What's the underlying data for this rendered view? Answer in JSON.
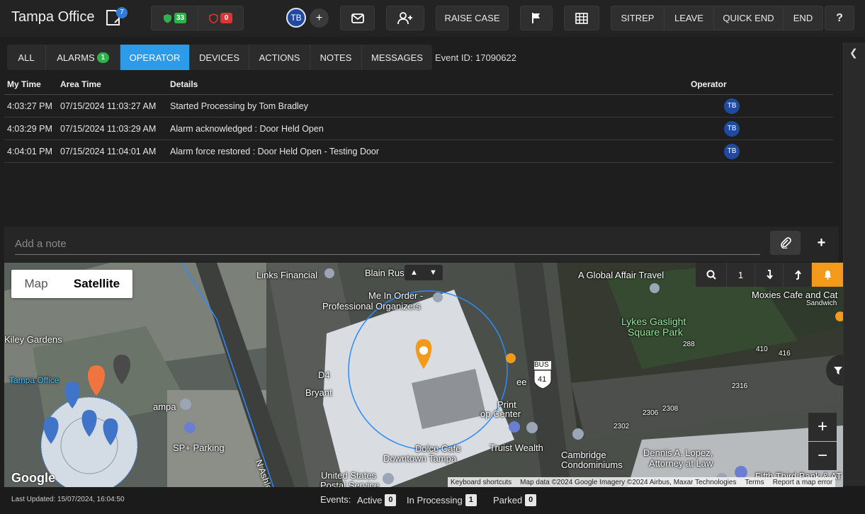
{
  "header": {
    "site_title": "Tampa Office",
    "doc_badge": "7",
    "secure_count": "33",
    "alert_count": "0",
    "user_initials": "TB",
    "add_user_plus": "+",
    "raise_case": "RAISE CASE",
    "sitrep": "SITREP",
    "leave": "LEAVE",
    "quick_end": "QUICK END",
    "end": "END",
    "help": "?"
  },
  "tabs": [
    {
      "label": "ALL"
    },
    {
      "label": "ALARMS",
      "badge": "1"
    },
    {
      "label": "OPERATOR",
      "active": true
    },
    {
      "label": "DEVICES"
    },
    {
      "label": "ACTIONS"
    },
    {
      "label": "NOTES"
    },
    {
      "label": "MESSAGES"
    }
  ],
  "event_id": "Event ID: 17090622",
  "log": {
    "headers": {
      "my_time": "My Time",
      "area_time": "Area Time",
      "details": "Details",
      "operator": "Operator"
    },
    "rows": [
      {
        "my_time": "4:03:27 PM",
        "area_time": "07/15/2024 11:03:27 AM",
        "details": "Started Processing by Tom Bradley",
        "operator": "TB"
      },
      {
        "my_time": "4:03:29 PM",
        "area_time": "07/15/2024 11:03:29 AM",
        "details": "Alarm acknowledged : Door Held Open",
        "operator": "TB"
      },
      {
        "my_time": "4:04:01 PM",
        "area_time": "07/15/2024 11:04:01 AM",
        "details": "Alarm force restored : Door Held Open - Testing Door",
        "operator": "TB"
      }
    ]
  },
  "note": {
    "placeholder": "Add a note"
  },
  "map": {
    "type_map": "Map",
    "type_satellite": "Satellite",
    "floor_level": "1",
    "zoom_in": "+",
    "zoom_out": "−",
    "google": "Google",
    "attribution": {
      "shortcuts": "Keyboard shortcuts",
      "data": "Map data ©2024 Google Imagery ©2024 Airbus, Maxar Technologies",
      "terms": "Terms",
      "report": "Report a map error"
    },
    "labels": {
      "links_financial": "Links Financial",
      "blain_rus": "Blain Rus",
      "me_in_order": "Me In Order -",
      "professional_organizers": "Professional Organizers",
      "a_global_affair": "A Global Affair Travel",
      "moxies": "Moxies Cafe and Cat",
      "sandwich": "Sandwich",
      "lykes_gaslight": "Lykes Gaslight",
      "square_park": "Square Park",
      "kiley_gardens": "Kiley Gardens",
      "tampa_office": "Tampa Office",
      "tampa": "ampa",
      "sp_parking": "SP+ Parking",
      "d4": "D4",
      "bryant": "Bryant",
      "ee": "ee",
      "print": "Print",
      "op_center": "op Center",
      "bus": "BUS",
      "route_41": "41",
      "dolce_cafe": "Dolce Cafe",
      "downtown_tampa": "Downtown Tampa",
      "truist_wealth": "Truist Wealth",
      "cambridge": "Cambridge",
      "condominiums": "Condominiums",
      "dennis_lopez": "Dennis A. Lopez,",
      "attorney": "Attorney at Law",
      "united_states": "United States",
      "postal_service": "Postal Service",
      "n_ashley": "N Ashley",
      "fifth_third": "Fifth Third Bank & AT",
      "n288": "288",
      "n410": "410",
      "n416": "416",
      "n2316": "2316",
      "n2306": "2306",
      "n2308": "2308",
      "n2302": "2302"
    }
  },
  "status": {
    "last_updated": "Last Updated: 15/07/2024, 16:04:50",
    "events_label": "Events:",
    "active_label": "Active",
    "active_count": "0",
    "processing_label": "In Processing",
    "processing_count": "1",
    "parked_label": "Parked",
    "parked_count": "0"
  },
  "colors": {
    "accent": "#2c9bea",
    "alarm_orange": "#f39a1b",
    "secure_green": "#2eb34a",
    "alert_red": "#e03434",
    "operator_blue": "#1f4aa0"
  }
}
